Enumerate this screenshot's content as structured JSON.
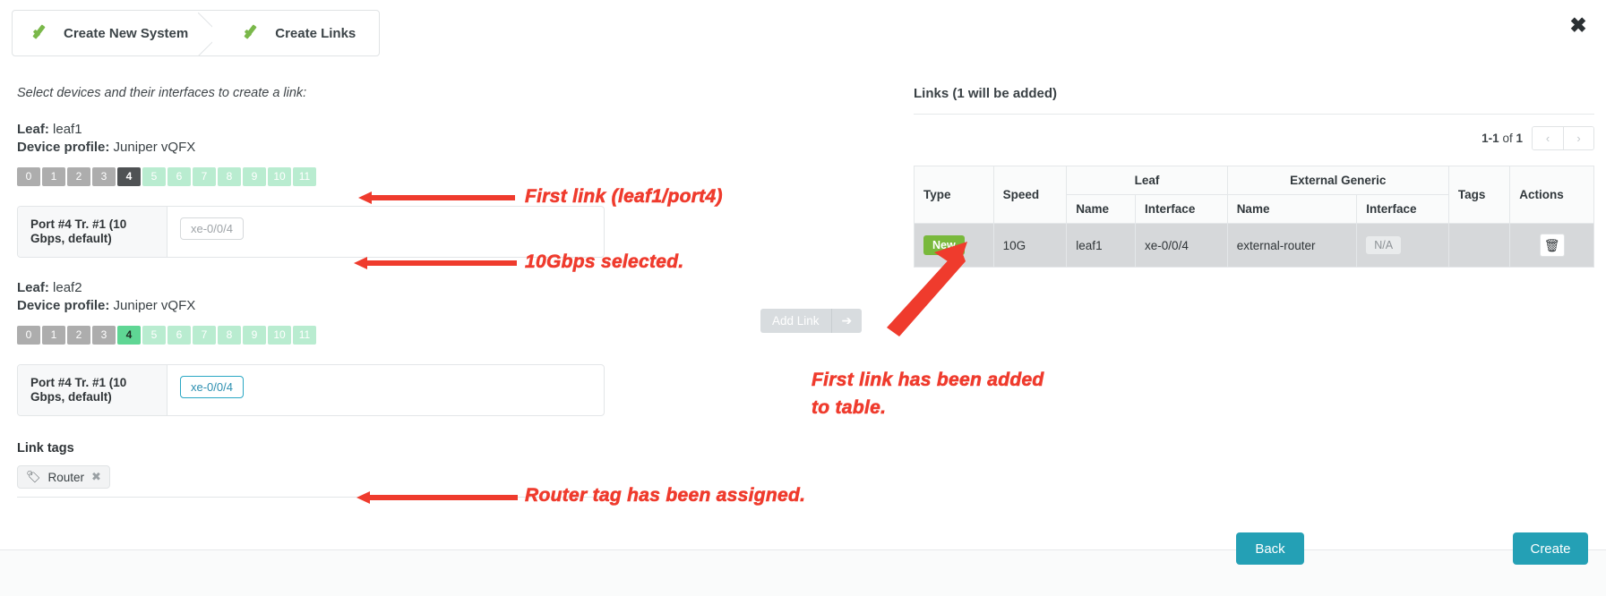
{
  "wizard": {
    "steps": [
      {
        "label": "Create New System",
        "icon": "check-icon"
      },
      {
        "label": "Create Links",
        "icon": "check-icon"
      }
    ]
  },
  "close_icon": "✖",
  "left": {
    "hint": "Select devices and their interfaces to create a link:",
    "devices": [
      {
        "role_label": "Leaf:",
        "name": "leaf1",
        "profile_label": "Device profile:",
        "profile": "Juniper vQFX",
        "ports": [
          {
            "n": "0",
            "state": "used"
          },
          {
            "n": "1",
            "state": "used"
          },
          {
            "n": "2",
            "state": "used"
          },
          {
            "n": "3",
            "state": "used"
          },
          {
            "n": "4",
            "state": "sel-dark"
          },
          {
            "n": "5",
            "state": "avail"
          },
          {
            "n": "6",
            "state": "avail"
          },
          {
            "n": "7",
            "state": "avail"
          },
          {
            "n": "8",
            "state": "avail"
          },
          {
            "n": "9",
            "state": "avail"
          },
          {
            "n": "10",
            "state": "avail"
          },
          {
            "n": "11",
            "state": "avail"
          }
        ],
        "iface_label": "Port #4 Tr. #1 (10 Gbps, default)",
        "iface_chip": "xe-0/0/4",
        "iface_chip_state": "muted"
      },
      {
        "role_label": "Leaf:",
        "name": "leaf2",
        "profile_label": "Device profile:",
        "profile": "Juniper vQFX",
        "ports": [
          {
            "n": "0",
            "state": "used"
          },
          {
            "n": "1",
            "state": "used"
          },
          {
            "n": "2",
            "state": "used"
          },
          {
            "n": "3",
            "state": "used"
          },
          {
            "n": "4",
            "state": "sel-green"
          },
          {
            "n": "5",
            "state": "avail"
          },
          {
            "n": "6",
            "state": "avail"
          },
          {
            "n": "7",
            "state": "avail"
          },
          {
            "n": "8",
            "state": "avail"
          },
          {
            "n": "9",
            "state": "avail"
          },
          {
            "n": "10",
            "state": "avail"
          },
          {
            "n": "11",
            "state": "avail"
          }
        ],
        "iface_label": "Port #4 Tr. #1 (10 Gbps, default)",
        "iface_chip": "xe-0/0/4",
        "iface_chip_state": "active"
      }
    ],
    "link_tags_title": "Link tags",
    "tags": [
      {
        "label": "Router",
        "remove_icon": "✖",
        "tag_icon": "🏷"
      }
    ]
  },
  "add_link": {
    "label": "Add Link",
    "arrow": "➔"
  },
  "right": {
    "title": "Links (1 will be added)",
    "pager": {
      "range": "1-1",
      "of_word": "of",
      "total": "1",
      "prev": "‹",
      "next": "›"
    },
    "table": {
      "group_headers": [
        {
          "label": "Type",
          "rowspan": 2
        },
        {
          "label": "Speed",
          "rowspan": 2
        },
        {
          "label": "Leaf",
          "colspan": 2
        },
        {
          "label": "External Generic",
          "colspan": 2
        },
        {
          "label": "Tags",
          "rowspan": 2
        },
        {
          "label": "Actions",
          "rowspan": 2
        }
      ],
      "sub_headers": [
        "Name",
        "Interface",
        "Name",
        "Interface"
      ],
      "rows": [
        {
          "type": "New",
          "speed": "10G",
          "leaf_name": "leaf1",
          "leaf_interface": "xe-0/0/4",
          "ext_name": "external-router",
          "ext_interface": "N/A",
          "tags": "",
          "action_icon": "🗑"
        }
      ]
    }
  },
  "footer": {
    "back": "Back",
    "create": "Create"
  },
  "annotations": [
    {
      "text": "First link (leaf1/port4)"
    },
    {
      "text": "10Gbps selected."
    },
    {
      "text": "First link has been added"
    },
    {
      "text": "to table."
    },
    {
      "text": "Router tag has been assigned."
    }
  ],
  "colors": {
    "accent": "#24a0b5",
    "badge_new": "#79b93c",
    "annotation": "#ef3b2d",
    "port_selected_dark": "#4f5254",
    "port_selected_green": "#5fd694",
    "port_available": "#b9ecd0",
    "port_used": "#adadad"
  }
}
